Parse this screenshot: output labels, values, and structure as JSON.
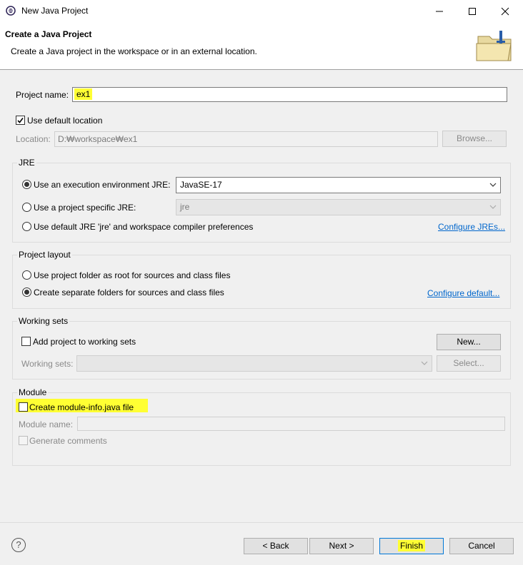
{
  "window": {
    "title": "New Java Project"
  },
  "banner": {
    "title": "Create a Java Project",
    "description": "Create a Java project in the workspace or in an external location."
  },
  "project": {
    "name_label": "Project name:",
    "name_value": "ex1",
    "use_default_label": "Use default location",
    "location_label": "Location:",
    "location_value": "D:₩workspace₩ex1",
    "browse_label": "Browse..."
  },
  "jre": {
    "title": "JRE",
    "option_env": "Use an execution environment JRE:",
    "env_value": "JavaSE-17",
    "option_specific": "Use a project specific JRE:",
    "specific_value": "jre",
    "option_default": "Use default JRE 'jre' and workspace compiler preferences",
    "configure_link": "Configure JREs..."
  },
  "layout": {
    "title": "Project layout",
    "option_root": "Use project folder as root for sources and class files",
    "option_separate": "Create separate folders for sources and class files",
    "configure_link": "Configure default..."
  },
  "working_sets": {
    "title": "Working sets",
    "add_label": "Add project to working sets",
    "new_button": "New...",
    "sets_label": "Working sets:",
    "select_button": "Select..."
  },
  "module": {
    "title": "Module",
    "create_label": "Create module-info.java file",
    "name_label": "Module name:",
    "generate_label": "Generate comments"
  },
  "footer": {
    "help_glyph": "?",
    "back": "< Back",
    "next": "Next >",
    "finish": "Finish",
    "cancel": "Cancel"
  },
  "colors": {
    "highlight": "#ffff33",
    "link": "#0066cc"
  }
}
